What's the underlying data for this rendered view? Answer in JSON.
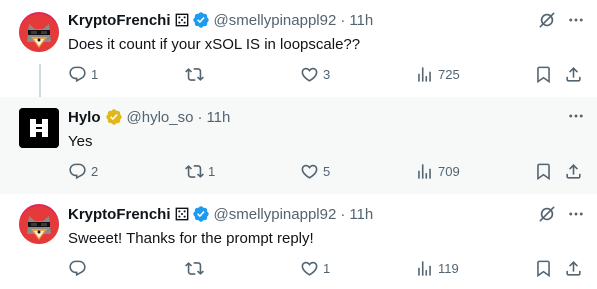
{
  "tweets": [
    {
      "name": "KryptoFrenchi",
      "handle": "@smellypinappl92",
      "dot": "·",
      "time": "11h",
      "text": "Does it count if your xSOL  IS in loopscale??",
      "replies": "1",
      "retweets": "",
      "likes": "3",
      "views": "725",
      "verified_badge": "blue",
      "avatar_icon": "cat-avatar-icon"
    },
    {
      "name": "Hylo",
      "handle": "@hylo_so",
      "dot": "·",
      "time": "11h",
      "text": "Yes",
      "replies": "2",
      "retweets": "1",
      "likes": "5",
      "views": "709",
      "verified_badge": "gold",
      "avatar_icon": "hylo-logo-icon"
    },
    {
      "name": "KryptoFrenchi",
      "handle": "@smellypinappl92",
      "dot": "·",
      "time": "11h",
      "text": "Sweeet! Thanks for the prompt reply!",
      "replies": "",
      "retweets": "",
      "likes": "1",
      "views": "119",
      "verified_badge": "blue",
      "avatar_icon": "cat-avatar-icon"
    }
  ],
  "colors": {
    "text": "#0f1419",
    "muted": "#536471",
    "verified_blue": "#1d9bf0",
    "verified_gold": "#e2b719",
    "thread_line": "#cfd9de",
    "highlight_bg": "#f7f9f9"
  }
}
